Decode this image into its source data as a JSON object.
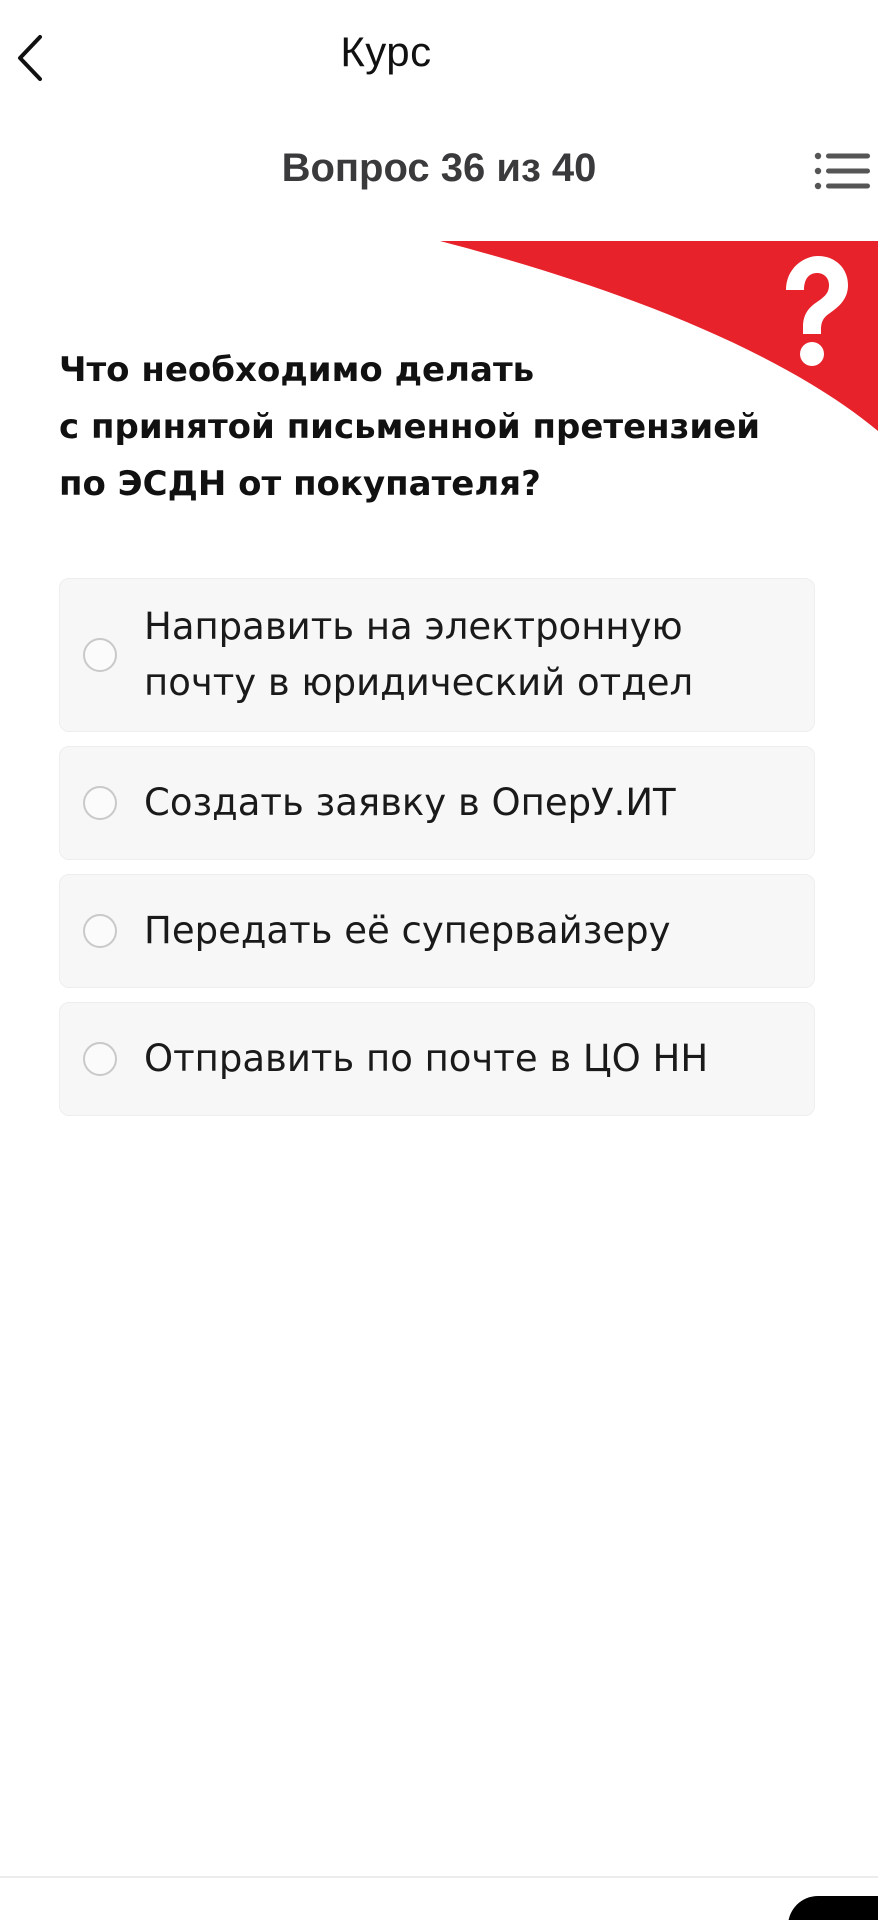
{
  "header": {
    "title": "Курс",
    "back_icon": "chevron-left-icon",
    "menu_icon": "list-menu-icon"
  },
  "quiz": {
    "progress_label": "Вопрос 36 из 40",
    "question": "Что необходимо делать\nс принятой письменной претензией\nпо ЭСДН от покупателя?",
    "options": [
      {
        "label": "Направить на электронную почту в юридический отдел",
        "selected": false
      },
      {
        "label": "Создать заявку в ОперУ.ИТ",
        "selected": false
      },
      {
        "label": "Передать её супервайзеру",
        "selected": false
      },
      {
        "label": "Отправить по почте в ЦО НН",
        "selected": false
      }
    ]
  },
  "banner": {
    "icon": "question-mark-icon",
    "accent_color": "#e8222a"
  },
  "colors": {
    "background": "#ffffff",
    "option_background": "#f7f7f7",
    "radio_border": "#c9c9c9",
    "text_primary": "#111111",
    "progress_text": "#3a3a3c"
  }
}
